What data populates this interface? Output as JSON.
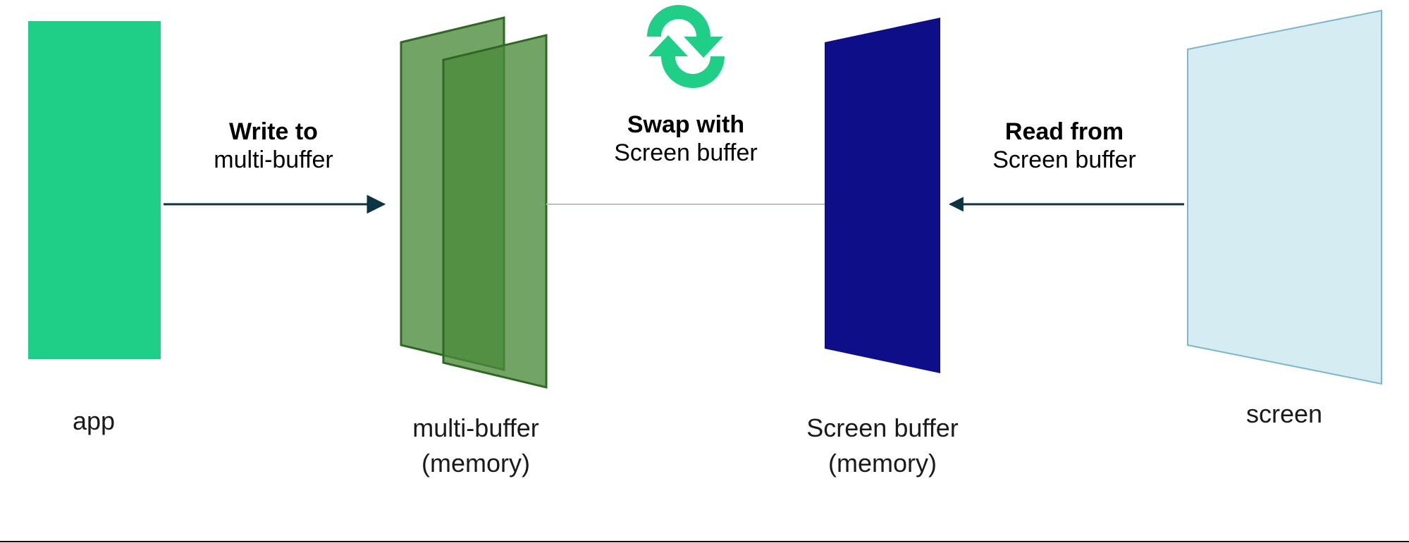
{
  "nodes": {
    "app": {
      "label": "app"
    },
    "multi_buffer": {
      "label_line1": "multi-buffer",
      "label_line2": "(memory)"
    },
    "screen_buffer": {
      "label_line1": "Screen buffer",
      "label_line2": "(memory)"
    },
    "screen": {
      "label": "screen"
    }
  },
  "edges": {
    "write": {
      "bold": "Write to",
      "rest": "multi-buffer"
    },
    "swap": {
      "bold": "Swap with",
      "rest": "Screen buffer"
    },
    "read": {
      "bold": "Read from",
      "rest": "Screen buffer"
    }
  },
  "colors": {
    "app_fill": "#1fcf87",
    "multi_fill": "#4a8a3a",
    "multi_stroke": "#2f6822",
    "screenbuf_fill": "#0e0e89",
    "screen_fill": "#d6ecf3",
    "screen_stroke": "#7db8c9",
    "arrow": "#0b3542",
    "swap_icon": "#1fcf87",
    "line_gray": "#b7c1c6"
  }
}
